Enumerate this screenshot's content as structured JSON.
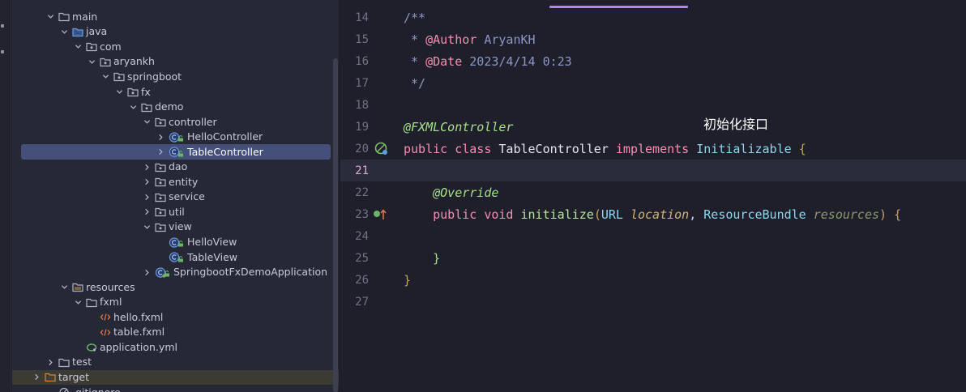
{
  "project_tree": {
    "items": [
      {
        "label": "main",
        "icon": "folder-icon",
        "expanded": true
      },
      {
        "label": "java",
        "icon": "source-folder-icon",
        "expanded": true
      },
      {
        "label": "com",
        "icon": "package-icon",
        "expanded": true
      },
      {
        "label": "aryankh",
        "icon": "package-icon",
        "expanded": true
      },
      {
        "label": "springboot",
        "icon": "package-icon",
        "expanded": true
      },
      {
        "label": "fx",
        "icon": "package-icon",
        "expanded": true
      },
      {
        "label": "demo",
        "icon": "package-icon",
        "expanded": true
      },
      {
        "label": "controller",
        "icon": "package-icon",
        "expanded": true
      },
      {
        "label": "HelloController",
        "icon": "class-icon",
        "expanded": false
      },
      {
        "label": "TableController",
        "icon": "class-icon",
        "expanded": false,
        "selected": true
      },
      {
        "label": "dao",
        "icon": "package-icon",
        "expanded": false
      },
      {
        "label": "entity",
        "icon": "package-icon",
        "expanded": false
      },
      {
        "label": "service",
        "icon": "package-icon",
        "expanded": false
      },
      {
        "label": "util",
        "icon": "package-icon",
        "expanded": false
      },
      {
        "label": "view",
        "icon": "package-icon",
        "expanded": true
      },
      {
        "label": "HelloView",
        "icon": "class-icon"
      },
      {
        "label": "TableView",
        "icon": "class-icon"
      },
      {
        "label": "SpringbootFxDemoApplication",
        "icon": "spring-class-icon",
        "expanded": false
      },
      {
        "label": "resources",
        "icon": "resources-folder-icon",
        "expanded": true
      },
      {
        "label": "fxml",
        "icon": "folder-icon",
        "expanded": true
      },
      {
        "label": "hello.fxml",
        "icon": "fxml-file-icon"
      },
      {
        "label": "table.fxml",
        "icon": "fxml-file-icon"
      },
      {
        "label": "application.yml",
        "icon": "yaml-file-icon"
      },
      {
        "label": "test",
        "icon": "folder-icon",
        "expanded": false
      },
      {
        "label": "target",
        "icon": "excluded-folder-icon",
        "expanded": false
      },
      {
        "label": ".gitignore",
        "icon": "ignore-file-icon"
      }
    ]
  },
  "editor": {
    "current_line": "21",
    "line_numbers": [
      "14",
      "15",
      "16",
      "17",
      "18",
      "19",
      "20",
      "21",
      "22",
      "23",
      "24",
      "25",
      "26",
      "27"
    ],
    "code": {
      "l14": {
        "text": "/**"
      },
      "l15": {
        "star": " * ",
        "tag": "@Author",
        "rest": " AryanKH"
      },
      "l16": {
        "star": " * ",
        "tag": "@Date",
        "rest": " 2023/4/14 0:23"
      },
      "l17": {
        "text": " */"
      },
      "l19": {
        "annotation": "@FXMLController"
      },
      "l20": {
        "kw1": "public",
        "kw2": "class",
        "name": "TableController",
        "kw3": "implements",
        "iface": "Initializable",
        "brace": "{"
      },
      "l22": {
        "annotation": "@Override"
      },
      "l23": {
        "kw1": "public",
        "kw2": "void",
        "method": "initialize",
        "open": "(",
        "type1": "URL",
        "param1": "location",
        "comma": ",",
        "type2": "ResourceBundle",
        "param2": "resources",
        "close": ")",
        "brace": "{"
      },
      "l25": {
        "brace": "}"
      },
      "l26": {
        "brace": "}"
      }
    },
    "overlay_note": "初始化接口"
  },
  "colors": {
    "keyword": "#f48fb1",
    "annotation": "#a6e08a",
    "type": "#8fd6ee",
    "comment": "#8c96c7",
    "selection": "#44507a"
  }
}
